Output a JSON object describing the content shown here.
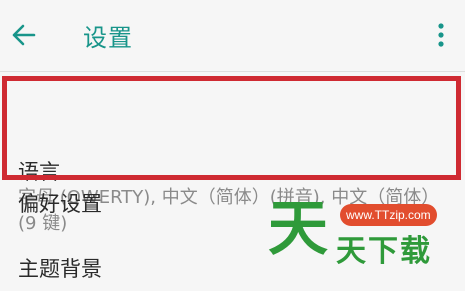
{
  "toolbar": {
    "title": "设置",
    "back_icon": "arrow-left-icon",
    "more_icon": "more-vertical-icon"
  },
  "settings": {
    "language": {
      "title": "语言",
      "summary": "字母 (QWERTY), 中文（简体）(拼音), 中文（简体）(9 键)"
    },
    "preferences": {
      "title": "偏好设置"
    },
    "theme": {
      "title": "主题背景"
    }
  },
  "watermark": {
    "url": "www.TTzip.com",
    "big_char": "天",
    "text": "天下载"
  },
  "colors": {
    "accent": "#18958a",
    "highlight_border": "#cf2a32",
    "watermark_green": "#2f9a3a",
    "watermark_badge": "#e24d2e",
    "background": "#f6f6f6"
  }
}
